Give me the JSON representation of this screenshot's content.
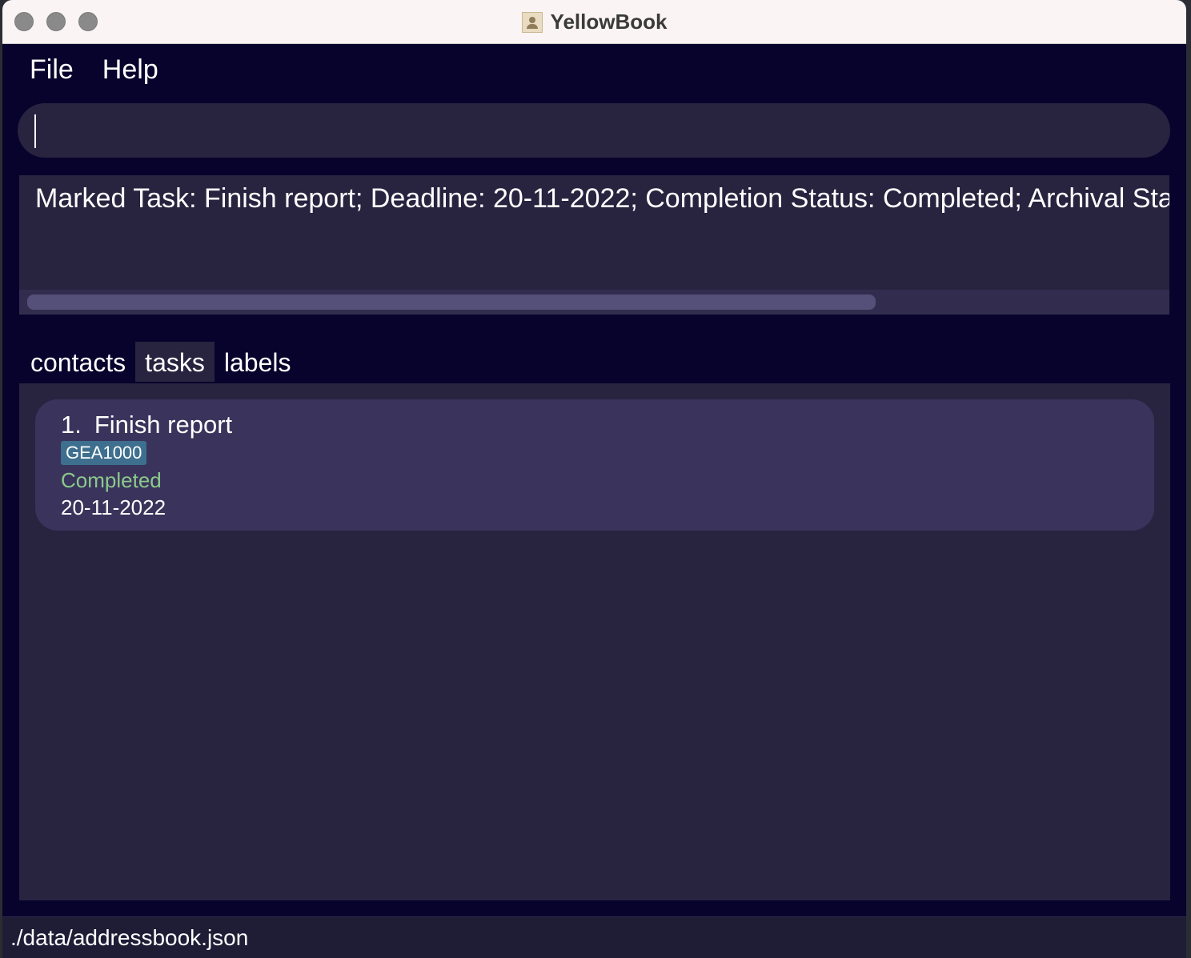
{
  "window": {
    "title": "YellowBook"
  },
  "menu": {
    "items": [
      {
        "label": "File"
      },
      {
        "label": "Help"
      }
    ]
  },
  "command": {
    "value": "",
    "placeholder": ""
  },
  "result": {
    "text": "Marked Task: Finish report; Deadline: 20-11-2022; Completion Status: Completed; Archival Status:"
  },
  "tabs": [
    {
      "label": "contacts",
      "active": false
    },
    {
      "label": "tasks",
      "active": true
    },
    {
      "label": "labels",
      "active": false
    }
  ],
  "task_list": [
    {
      "index": "1.",
      "title": "Finish report",
      "label": "GEA1000",
      "status": "Completed",
      "deadline": "20-11-2022"
    }
  ],
  "status_bar": {
    "path": "./data/addressbook.json"
  },
  "colors": {
    "background": "#07032c",
    "panel": "#28233f",
    "card": "#3a345c",
    "tag": "#3e6f8f",
    "completed": "#8bc98b"
  },
  "icons": {
    "title_icon": "address-book-icon"
  }
}
